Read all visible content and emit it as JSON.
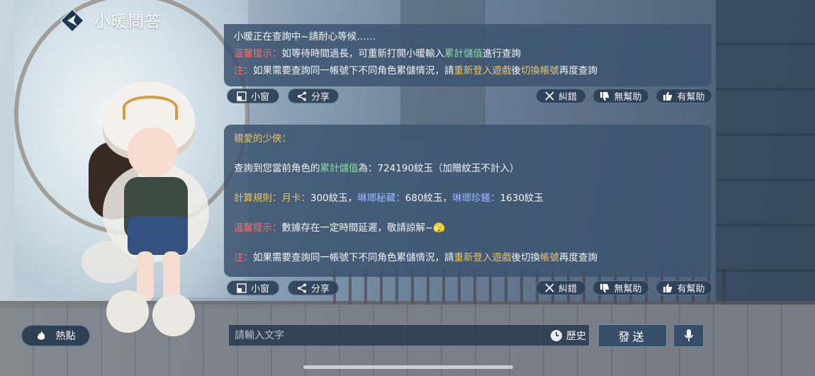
{
  "header": {
    "title": "小暖問答",
    "logo_icon": "diamond-logo-icon"
  },
  "message1": {
    "line1": "小暖正在查詢中~請耐心等候……",
    "tip_label": "溫馨提示：",
    "tip_pre": "如等待時間過長，可重新打開小暖輸入",
    "tip_keyword": "累計儲值",
    "tip_post": "進行查詢",
    "note_label": "注：",
    "note_pre": "如果需要查詢同一帳號下不同角色累儲情況，請",
    "note_link1": "重新登入遊戲",
    "note_mid": "後",
    "note_link2": "切換帳號",
    "note_post": "再度查詢"
  },
  "message2": {
    "greeting": "親愛的少俠：",
    "query_pre": "查詢到您當前角色的",
    "query_keyword": "累計儲值",
    "query_post": "為：724190紋玉（加贈紋玉不計入）",
    "rule_label": "計算規則：",
    "rule_item1_label": "月卡：",
    "rule_item1_value": "300紋玉，",
    "rule_item2_label": "琳瑯秘藏：",
    "rule_item2_value": "680紋玉，",
    "rule_item3_label": "琳瑯珍饈：",
    "rule_item3_value": "1630紋玉",
    "tip_label": "溫馨提示：",
    "tip_text": "數據存在一定時間延遲，敬請諒解~",
    "tip_emoji": "🫣",
    "note_label": "注：",
    "note_pre": "如果需要查詢同一帳號下不同角色累儲情況，請",
    "note_link1": "重新登入遊戲",
    "note_mid": "後切換",
    "note_link2": "帳號",
    "note_post": "再度查詢"
  },
  "actions": {
    "mini_window": "小窗",
    "share": "分享",
    "correct": "糾錯",
    "unhelpful": "無幫助",
    "helpful": "有幫助"
  },
  "bottom": {
    "hot_label": "熱點",
    "input_placeholder": "請輸入文字",
    "history_label": "歷史",
    "send_label": "發送"
  },
  "colors": {
    "card_bg": "#3c5470",
    "warn_red": "#ff6b6b",
    "keyword_green": "#8cd9a6",
    "link_gold": "#e8c46a",
    "rule_blue": "#9bb7ff"
  }
}
